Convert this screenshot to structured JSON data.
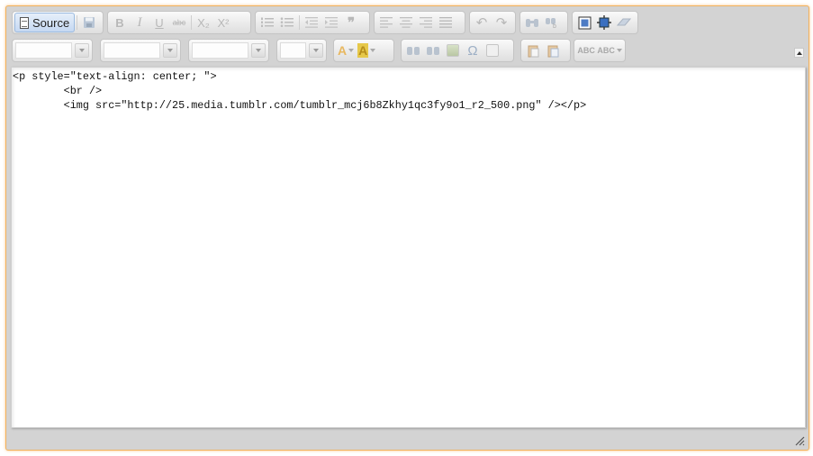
{
  "toolbar": {
    "source_label": "Source",
    "bold_label": "B",
    "italic_label": "I",
    "underline_label": "U",
    "strike_label": "abc",
    "subscript_label": "X₂",
    "superscript_label": "X²",
    "blockquote_label": "❞",
    "undo_label": "↶",
    "redo_label": "↷",
    "special_char_label": "Ω",
    "text_color_label": "A",
    "bg_color_label": "A",
    "spell_label": "ABC",
    "scayt_label": "ABC"
  },
  "combos": {
    "styles_value": "",
    "format_value": "",
    "font_value": "",
    "size_value": ""
  },
  "editor": {
    "source_html": "<p style=\"text-align: center; \">\n\t<br />\n\t<img src=\"http://25.media.tumblr.com/tumblr_mcj6b8Zkhy1qc3fy9o1_r2_500.png\" /></p>"
  },
  "colors": {
    "frame_border": "#f2b15c",
    "toolbar_bg": "#d3d3d3",
    "source_active": "#c5d8f2",
    "text_color_icon": "#e8b860",
    "bg_color_icon": "#e6c84a"
  }
}
